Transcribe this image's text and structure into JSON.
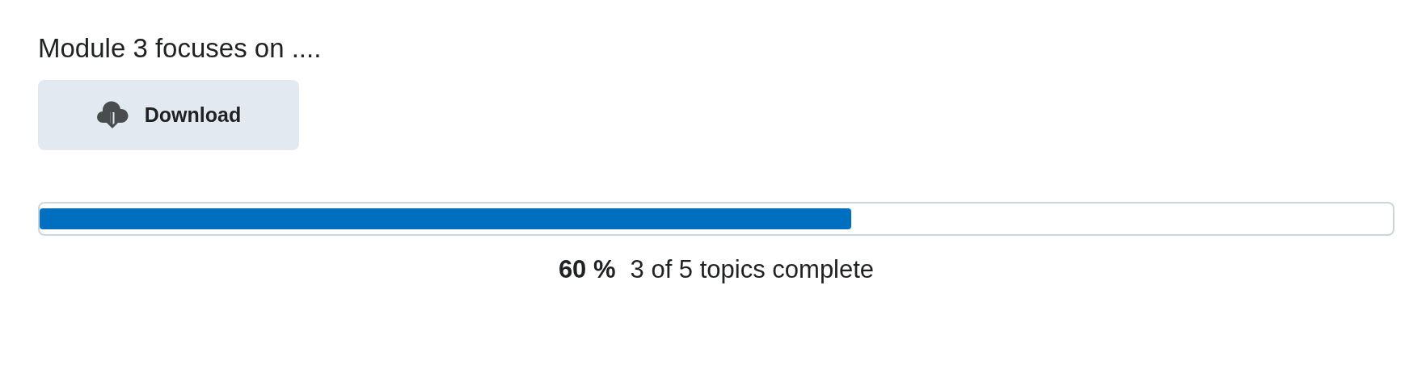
{
  "description": "Module 3 focuses on ....",
  "download_button": {
    "label": "Download"
  },
  "progress": {
    "level": 0.6,
    "percent": "60 %",
    "summary": "3 of 5 topics complete"
  }
}
